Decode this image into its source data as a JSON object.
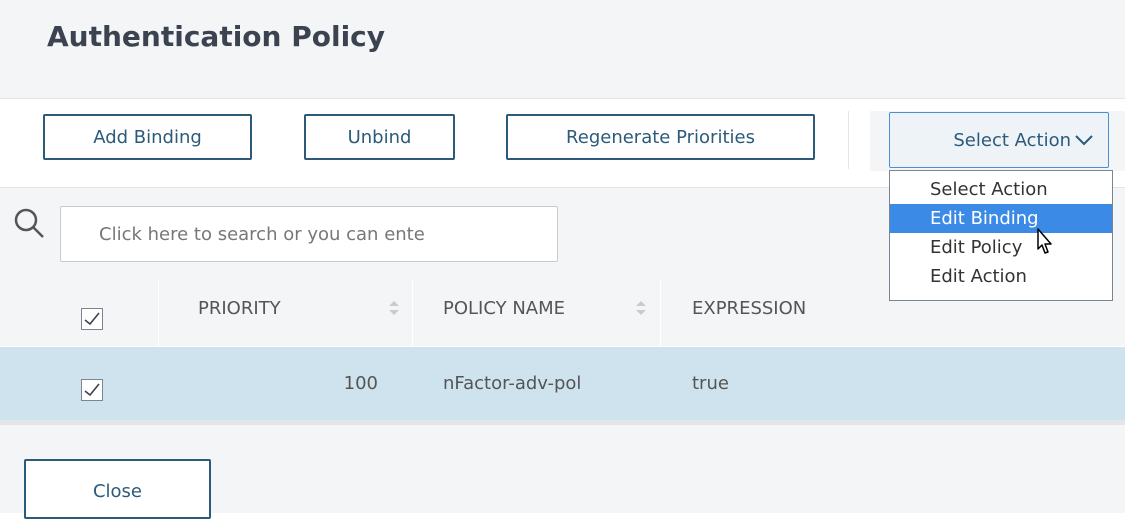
{
  "header": {
    "title": "Authentication Policy"
  },
  "toolbar": {
    "add_binding": "Add Binding",
    "unbind": "Unbind",
    "regenerate": "Regenerate Priorities",
    "select_action": "Select Action"
  },
  "dropdown": {
    "items": [
      {
        "label": "Select Action",
        "selected": false
      },
      {
        "label": "Edit Binding",
        "selected": true
      },
      {
        "label": "Edit Policy",
        "selected": false
      },
      {
        "label": "Edit Action",
        "selected": false
      }
    ]
  },
  "search": {
    "placeholder": "Click here to search or you can ente"
  },
  "table": {
    "columns": [
      "PRIORITY",
      "POLICY NAME",
      "EXPRESSION"
    ],
    "rows": [
      {
        "checked": true,
        "priority": "100",
        "policy_name": "nFactor-adv-pol",
        "expression": "true"
      }
    ]
  },
  "footer": {
    "close": "Close"
  },
  "icons": {
    "search": "search-icon",
    "chevron": "chevron-down-icon",
    "sort": "sort-icon",
    "check": "check-icon",
    "cursor": "cursor-icon"
  },
  "colors": {
    "accent": "#2c5a7a",
    "selection": "#3b8ae6",
    "row_highlight": "#cfe3ee",
    "panel": "#f4f5f6"
  }
}
